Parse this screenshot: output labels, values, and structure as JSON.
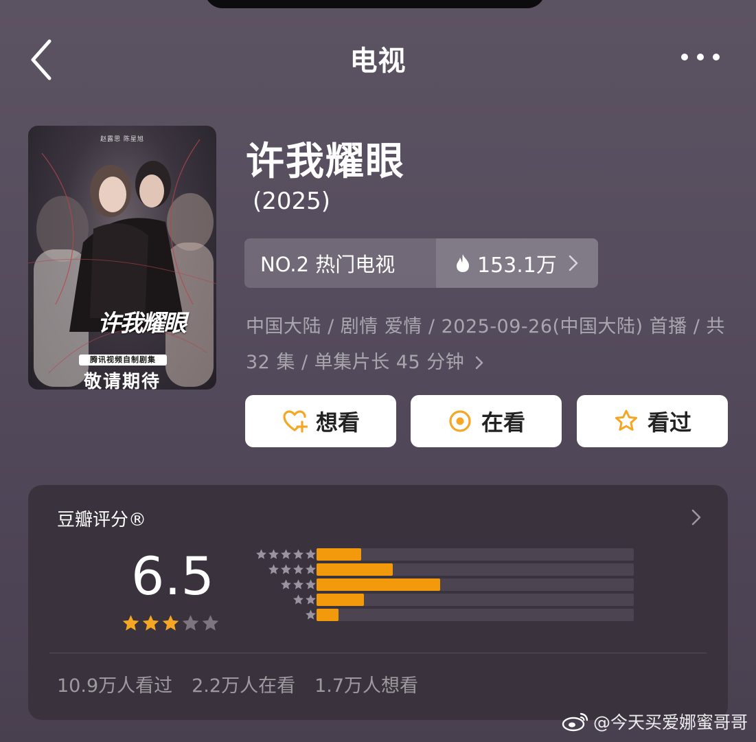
{
  "header": {
    "title": "电视",
    "back_icon": "chevron-left-icon",
    "more_icon": "ellipsis-icon"
  },
  "poster": {
    "credits": "赵露思  陈星旭",
    "calligraphy_title": "许我耀眼",
    "badge": "腾讯视频自制剧集",
    "tagline": "敬请期待"
  },
  "show": {
    "title": "许我耀眼",
    "year": "(2025)"
  },
  "ranking": {
    "label": "NO.2 热门电视",
    "heat": "153.1万"
  },
  "meta": {
    "line": "中国大陆 / 剧情 爱情 / 2025-09-26(中国大陆) 首播 / 共 32 集 / 单集片长 45 分钟"
  },
  "actions": {
    "want": "想看",
    "watching": "在看",
    "watched": "看过"
  },
  "rating": {
    "title": "豆瓣评分®",
    "score": "6.5",
    "stars": 3,
    "distribution": [
      {
        "stars": 5,
        "fraction": 0.14
      },
      {
        "stars": 4,
        "fraction": 0.24
      },
      {
        "stars": 3,
        "fraction": 0.39
      },
      {
        "stars": 2,
        "fraction": 0.15
      },
      {
        "stars": 1,
        "fraction": 0.07
      }
    ],
    "stats": {
      "watched": "10.9万人看过",
      "watching": "2.2万人在看",
      "want": "1.7万人想看"
    }
  },
  "watermark": {
    "text": "@今天买爱娜蜜哥哥"
  },
  "colors": {
    "accent": "#f29a0c",
    "icon_orange": "#f5a623",
    "card_bg": "#3a333e"
  }
}
